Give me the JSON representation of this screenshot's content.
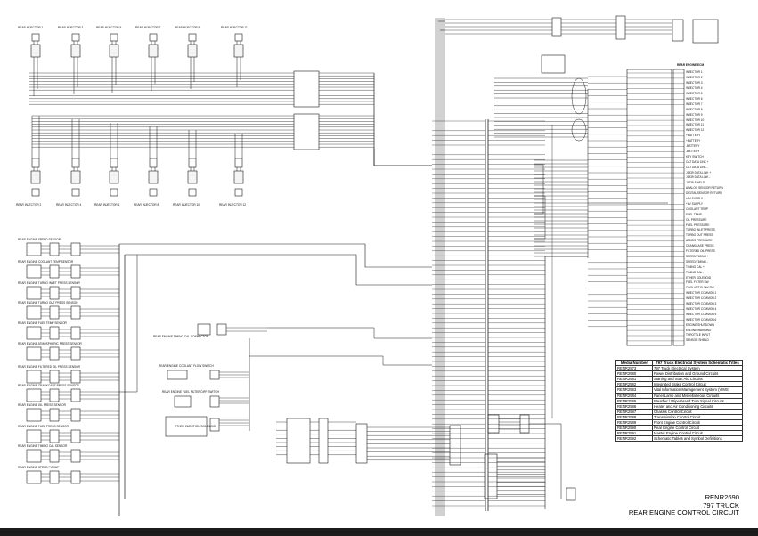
{
  "title_block": {
    "media_number": "RENR2690",
    "machine": "797 TRUCK",
    "circuit": "REAR ENGINE CONTROL CIRCUIT"
  },
  "titles_table": {
    "col_media": "Media Number",
    "col_title": "797 Truck Electrical System Schematic Titles",
    "rows": [
      {
        "media": "RENR2573",
        "title": "797 Truck Electrical System"
      },
      {
        "media": "RENR2580",
        "title": "Power Distribution and Ground Circuits"
      },
      {
        "media": "RENR2581",
        "title": "Starting and Start Aid Circuits"
      },
      {
        "media": "RENR2582",
        "title": "Integrated Brake Control Circuit"
      },
      {
        "media": "RENR2583",
        "title": "Vital Information Management System (VIMS)"
      },
      {
        "media": "RENR2584",
        "title": "Panel Lamp and Miscellaneous Circuits"
      },
      {
        "media": "RENR2585",
        "title": "Weather / Wiper/Hand Turn Signal Circuits"
      },
      {
        "media": "RENR2586",
        "title": "Heater and Air Conditioning Circuits"
      },
      {
        "media": "RENR2587",
        "title": "Chassis Control Circuit"
      },
      {
        "media": "RENR2588",
        "title": "Transmission Control Circuit"
      },
      {
        "media": "RENR2589",
        "title": "Front Engine Control Circuit"
      },
      {
        "media": "RENR2590",
        "title": "Rear Engine Control Circuit"
      },
      {
        "media": "RENR2591",
        "title": "Master Engine Control Circuit"
      },
      {
        "media": "RENR2592",
        "title": "Schematic Tables and Symbol Definitions"
      }
    ]
  },
  "injectors_top": [
    "REAR INJECTOR 1",
    "REAR INJECTOR 3",
    "REAR INJECTOR 5",
    "REAR INJECTOR 7",
    "REAR INJECTOR 9",
    "REAR INJECTOR 11"
  ],
  "injectors_bottom": [
    "REAR INJECTOR 2",
    "REAR INJECTOR 4",
    "REAR INJECTOR 6",
    "REAR INJECTOR 8",
    "REAR INJECTOR 10",
    "REAR INJECTOR 12"
  ],
  "sensors": [
    "REAR ENGINE SPEED SENSOR",
    "REAR ENGINE COOLANT TEMP SENSOR",
    "REAR ENGINE TURBO INLET PRESS SENSOR",
    "REAR ENGINE TURBO OUT PRESS SENSOR",
    "REAR ENGINE FUEL TEMP SENSOR",
    "REAR ENGINE ATMOSPHERIC PRESS SENSOR",
    "REAR ENGINE FILTERED OIL PRESS SENSOR",
    "REAR ENGINE CRANKCASE PRESS SENSOR",
    "REAR ENGINE OIL PRESS SENSOR",
    "REAR ENGINE FUEL PRESS SENSOR",
    "REAR ENGINE TIMING CAL SENSOR",
    "REAR ENGINE SPEED PICKUP"
  ],
  "mid_labels": {
    "timing_cal": "REAR ENGINE TIMING CAL CONNECTOR",
    "coolant_flow": "REAR ENGINE COOLANT FLOW SWITCH",
    "fuel_filter": "REAR ENGINE FUEL FILTER DIFF SWITCH",
    "ether": "ETHER INJECTION SOLENOID"
  },
  "ecm_label": "REAR ENGINE ECM",
  "pin_list": [
    "INJECTOR 1",
    "INJECTOR 2",
    "INJECTOR 3",
    "INJECTOR 4",
    "INJECTOR 5",
    "INJECTOR 6",
    "INJECTOR 7",
    "INJECTOR 8",
    "INJECTOR 9",
    "INJECTOR 10",
    "INJECTOR 11",
    "INJECTOR 12",
    "+BATTERY",
    "+BATTERY",
    "-BATTERY",
    "-BATTERY",
    "KEY SWITCH",
    "CAT DATA LINK +",
    "CAT DATA LINK -",
    "J1939 DATA LINK +",
    "J1939 DATA LINK -",
    "J1939 SHIELD",
    "ANALOG SENSOR RETURN",
    "DIGITAL SENSOR RETURN",
    "+5V SUPPLY",
    "+8V SUPPLY",
    "COOLANT TEMP",
    "FUEL TEMP",
    "OIL PRESSURE",
    "FUEL PRESSURE",
    "TURBO INLET PRESS",
    "TURBO OUT PRESS",
    "ATMOS PRESSURE",
    "CRANKCASE PRESS",
    "FILTERED OIL PRESS",
    "SPEED/TIMING +",
    "SPEED/TIMING -",
    "TIMING CAL +",
    "TIMING CAL -",
    "ETHER SOLENOID",
    "FUEL FILTER SW",
    "COOLANT FLOW SW",
    "INJECTOR COMMON 1",
    "INJECTOR COMMON 2",
    "INJECTOR COMMON 3",
    "INJECTOR COMMON 4",
    "INJECTOR COMMON 5",
    "INJECTOR COMMON 6",
    "ENGINE SHUTDOWN",
    "ENGINE WARNING",
    "THROTTLE INPUT",
    "SENSOR SHIELD"
  ],
  "colors": {
    "line": "#1a1a1a",
    "band": "#1c1c1c",
    "background": "#ffffff"
  }
}
